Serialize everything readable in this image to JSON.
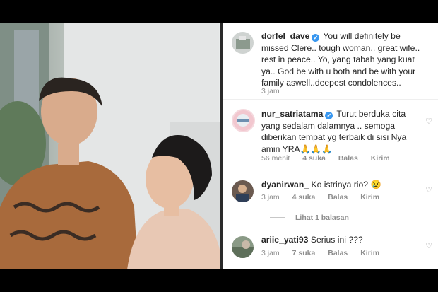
{
  "comments": [
    {
      "username": "dorfel_dave",
      "verified": true,
      "text": "You will definitely be missed Clere.. tough woman.. great wife.. rest in peace.. Yo, yang tabah yang kuat ya.. God be with u both and be with your family aswell..deepest condolences..",
      "time": "3 jam"
    },
    {
      "username": "nur_satriatama",
      "verified": true,
      "text": "Turut berduka cita yang sedalam dalamnya .. semoga diberikan tempat yg terbaik di sisi Nya amin YRA🙏🙏🙏",
      "time": "56 menit",
      "likes": "4 suka",
      "reply": "Balas",
      "send": "Kirim"
    },
    {
      "username": "dyanirwan_",
      "verified": false,
      "text": "Ko istrinya rio? 😢",
      "time": "3 jam",
      "likes": "4 suka",
      "reply": "Balas",
      "send": "Kirim",
      "view_replies": "Lihat 1 balasan"
    },
    {
      "username": "ariie_yati93",
      "verified": false,
      "text": "Serius ini ???",
      "time": "3 jam",
      "likes": "7 suka",
      "reply": "Balas",
      "send": "Kirim"
    }
  ],
  "icons": {
    "like": "heart-outline-icon",
    "verified": "verified-badge-icon"
  },
  "colors": {
    "verified": "#3897f0",
    "muted": "#8e8e8e",
    "text": "#262626"
  }
}
